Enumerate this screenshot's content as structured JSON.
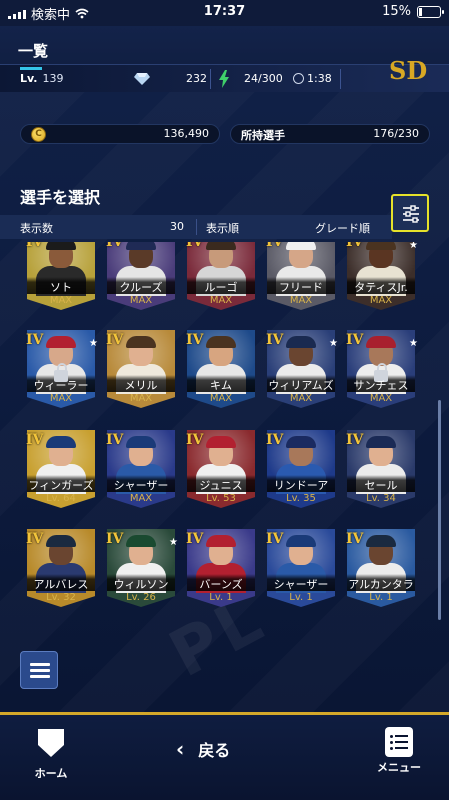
{
  "status": {
    "carrier": "検索中",
    "time": "17:37",
    "battery": "15%",
    "battery_level": 0.15
  },
  "header": {
    "title": "一覧",
    "level_label": "Lv.",
    "level_value": "139",
    "gems": "232",
    "stamina": "24/300",
    "timer": "1:38",
    "team_logo": "SD"
  },
  "currency": {
    "coins": "136,490",
    "coin_symbol": "C",
    "roster_label": "所持選手",
    "roster_value": "176/230"
  },
  "section": {
    "title": "選手を選択",
    "display_count_label": "表示数",
    "display_count_value": "30",
    "sort_label": "表示順",
    "sort_value": "グレード順"
  },
  "cards": [
    {
      "name": "ソト",
      "level": "MAX",
      "grade": "IV",
      "star": false,
      "lock": false,
      "bg": "#b7a13a",
      "cap": "#1b1b1b",
      "skin": "#8a5a3a",
      "uniform": "#2a2a2a"
    },
    {
      "name": "クルーズ",
      "level": "MAX",
      "grade": "IV",
      "star": false,
      "lock": false,
      "bg": "#4a3c7a",
      "cap": "#1f2a55",
      "skin": "#5a3a28",
      "uniform": "#e5e5e5"
    },
    {
      "name": "ルーゴ",
      "level": "MAX",
      "grade": "IV",
      "star": false,
      "lock": false,
      "bg": "#7a2a3a",
      "cap": "#3a2a1e",
      "skin": "#c79a7a",
      "uniform": "#d6d6d6"
    },
    {
      "name": "フリード",
      "level": "MAX",
      "grade": "IV",
      "star": false,
      "lock": false,
      "bg": "#5a5a66",
      "cap": "#f0f0f0",
      "skin": "#d5a688",
      "uniform": "#e9e9e9"
    },
    {
      "name": "タティスJr.",
      "level": "MAX",
      "grade": "IV",
      "star": true,
      "lock": false,
      "bg": "#3c2e2a",
      "cap": "#4a3320",
      "skin": "#5a3522",
      "uniform": "#e8e2d2"
    },
    {
      "name": "ウィーラー",
      "level": "MAX",
      "grade": "IV",
      "star": true,
      "lock": true,
      "bg": "#2a5aa8",
      "cap": "#b22030",
      "skin": "#d7a88a",
      "uniform": "#e8e8e8"
    },
    {
      "name": "メリル",
      "level": "MAX",
      "grade": "IV",
      "star": false,
      "lock": false,
      "bg": "#b88a3a",
      "cap": "#4a3320",
      "skin": "#e0b090",
      "uniform": "#efe9dc"
    },
    {
      "name": "キム",
      "level": "MAX",
      "grade": "IV",
      "star": false,
      "lock": false,
      "bg": "#1e4a8a",
      "cap": "#4a3320",
      "skin": "#d7a580",
      "uniform": "#e8e8e8"
    },
    {
      "name": "ウィリアムズ",
      "level": "MAX",
      "grade": "IV",
      "star": true,
      "lock": false,
      "bg": "#2a3f78",
      "cap": "#1a2a50",
      "skin": "#6a4530",
      "uniform": "#ececec"
    },
    {
      "name": "サンチェス",
      "level": "MAX",
      "grade": "IV",
      "star": true,
      "lock": true,
      "bg": "#2a3e7a",
      "cap": "#a8202e",
      "skin": "#a8785a",
      "uniform": "#ededed"
    },
    {
      "name": "フィンガーズ",
      "level": "Lv. 64",
      "grade": "IV",
      "star": false,
      "lock": false,
      "bg": "#c8a030",
      "cap": "#1a3a78",
      "skin": "#e0b090",
      "uniform": "#f0f0f0"
    },
    {
      "name": "シャーザー",
      "level": "MAX",
      "grade": "IV",
      "star": false,
      "lock": false,
      "bg": "#2a3a8a",
      "cap": "#1a3a78",
      "skin": "#e0b090",
      "uniform": "#2a5aa8"
    },
    {
      "name": "ジュニス",
      "level": "Lv. 53",
      "grade": "IV",
      "star": false,
      "lock": false,
      "bg": "#8a2a2e",
      "cap": "#b22030",
      "skin": "#e0b090",
      "uniform": "#f0f0f0"
    },
    {
      "name": "リンドーア",
      "level": "Lv. 35",
      "grade": "IV",
      "star": false,
      "lock": false,
      "bg": "#1e3a8a",
      "cap": "#1a2a60",
      "skin": "#a8785a",
      "uniform": "#2a5ab0"
    },
    {
      "name": "セール",
      "level": "Lv. 34",
      "grade": "IV",
      "star": false,
      "lock": false,
      "bg": "#2a3a6a",
      "cap": "#1a2a55",
      "skin": "#e0b090",
      "uniform": "#ececec"
    },
    {
      "name": "アルバレス",
      "level": "Lv. 32",
      "grade": "IV",
      "star": false,
      "lock": false,
      "bg": "#b88a2a",
      "cap": "#1a2a40",
      "skin": "#6a4530",
      "uniform": "#2a3a70"
    },
    {
      "name": "ウィルソン",
      "level": "Lv. 26",
      "grade": "IV",
      "star": true,
      "lock": false,
      "bg": "#2a4a3a",
      "cap": "#1a4a30",
      "skin": "#e0b090",
      "uniform": "#f0f0f0"
    },
    {
      "name": "バーンズ",
      "level": "Lv. 1",
      "grade": "IV",
      "star": false,
      "lock": false,
      "bg": "#3a3a8a",
      "cap": "#b22030",
      "skin": "#e0b090",
      "uniform": "#b22030"
    },
    {
      "name": "シャーザー",
      "level": "Lv. 1",
      "grade": "IV",
      "star": false,
      "lock": false,
      "bg": "#2a4a9a",
      "cap": "#1a3a78",
      "skin": "#e0b090",
      "uniform": "#2a5aa8"
    },
    {
      "name": "アルカンタラ",
      "level": "Lv. 1",
      "grade": "IV",
      "star": false,
      "lock": false,
      "bg": "#2a5aa0",
      "cap": "#1a2a40",
      "skin": "#6a4530",
      "uniform": "#ececec"
    }
  ],
  "nav": {
    "home_label": "ホーム",
    "back_label": "戻る",
    "menu_label": "メニュー"
  },
  "colors": {
    "accent_gold": "#d4a82a",
    "filter_border": "#e6e22a",
    "level_bar": "#35c4e8"
  }
}
